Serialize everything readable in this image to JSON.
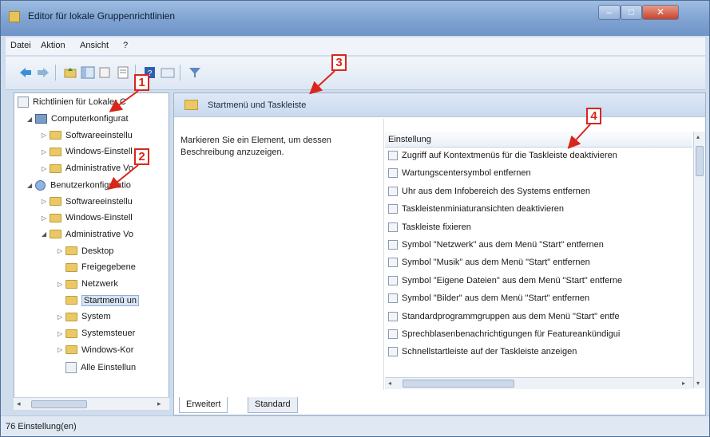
{
  "window": {
    "title": "Editor für lokale Gruppenrichtlinien"
  },
  "menu": [
    "Datei",
    "Aktion",
    "Ansicht",
    "?"
  ],
  "tree": {
    "root": "Richtlinien für Lokaler C",
    "items": [
      {
        "label": "Computerkonfigurat",
        "level": 1,
        "icon": "computer-icon"
      },
      {
        "label": "Softwareeinstellu",
        "level": 2,
        "icon": "folder-icon"
      },
      {
        "label": "Windows-Einstell",
        "level": 2,
        "icon": "folder-icon"
      },
      {
        "label": "Administrative Vo",
        "level": 2,
        "icon": "folder-icon"
      },
      {
        "label": "Benutzerkonfiguratio",
        "level": 1,
        "icon": "user-icon"
      },
      {
        "label": "Softwareeinstellu",
        "level": 2,
        "icon": "folder-icon"
      },
      {
        "label": "Windows-Einstell",
        "level": 2,
        "icon": "folder-icon"
      },
      {
        "label": "Administrative Vo",
        "level": 2,
        "icon": "folder-icon"
      },
      {
        "label": "Desktop",
        "level": 3,
        "icon": "folder-icon"
      },
      {
        "label": "Freigegebene",
        "level": 3,
        "icon": "folder-icon"
      },
      {
        "label": "Netzwerk",
        "level": 3,
        "icon": "folder-icon"
      },
      {
        "label": "Startmenü un",
        "level": 3,
        "icon": "folder-icon",
        "selected": true
      },
      {
        "label": "System",
        "level": 3,
        "icon": "folder-icon"
      },
      {
        "label": "Systemsteuer",
        "level": 3,
        "icon": "folder-icon"
      },
      {
        "label": "Windows-Kor",
        "level": 3,
        "icon": "folder-icon"
      },
      {
        "label": "Alle Einstellun",
        "level": 3,
        "icon": "policy-icon"
      }
    ]
  },
  "pane": {
    "header": "Startmenü und Taskleiste",
    "description": "Markieren Sie ein Element, um dessen Beschreibung anzuzeigen.",
    "column": "Einstellung",
    "settings": [
      "Zugriff auf Kontextmenüs für die Taskleiste deaktivieren",
      "Wartungscentersymbol entfernen",
      "Uhr aus dem Infobereich des Systems entfernen",
      "Taskleistenminiaturansichten deaktivieren",
      "Taskleiste fixieren",
      "Symbol \"Netzwerk\" aus dem Menü \"Start\" entfernen",
      "Symbol \"Musik\" aus dem Menü \"Start\" entfernen",
      "Symbol \"Eigene Dateien\" aus dem Menü \"Start\" entferne",
      "Symbol \"Bilder\" aus dem Menü \"Start\" entfernen",
      "Standardprogrammgruppen aus dem Menü \"Start\" entfe",
      "Sprechblasenbenachrichtigungen für Featureankündigui",
      "Schnellstartleiste auf der Taskleiste anzeigen"
    ],
    "tabs": [
      "Erweitert",
      "Standard"
    ]
  },
  "status": "76 Einstellung(en)",
  "callouts": [
    "1",
    "2",
    "3",
    "4"
  ],
  "colors": {
    "callout": "#d9261c",
    "titlebar": "#7fa2d1"
  }
}
